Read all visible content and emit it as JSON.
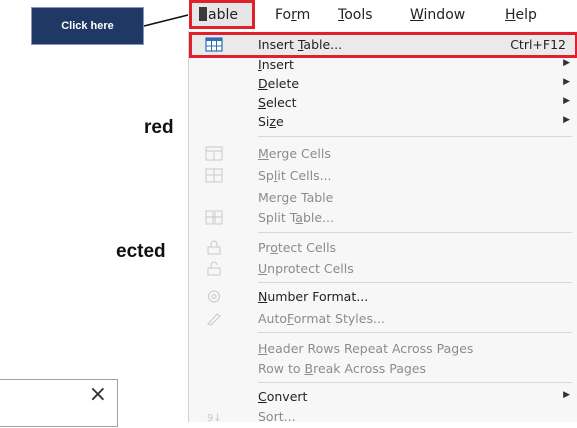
{
  "callout": {
    "label": "Click here"
  },
  "background_text": {
    "line1": "red",
    "line2": "ected"
  },
  "dialog": {
    "close_symbol": "×"
  },
  "menubar": {
    "items": [
      {
        "pre": "",
        "acc": "T",
        "post": "able",
        "display_cut": "able"
      },
      {
        "pre": "Fo",
        "acc": "r",
        "post": "m"
      },
      {
        "pre": "",
        "acc": "T",
        "post": "ools"
      },
      {
        "pre": "",
        "acc": "W",
        "post": "indow"
      },
      {
        "pre": "",
        "acc": "H",
        "post": "elp"
      }
    ]
  },
  "menu": {
    "items": [
      {
        "pre": "Insert ",
        "acc": "T",
        "post": "able...",
        "shortcut": "Ctrl+F12",
        "enabled": true,
        "icon": "insert-table-icon"
      },
      {
        "pre": "",
        "acc": "I",
        "post": "nsert",
        "submenu": true,
        "enabled": true
      },
      {
        "pre": "",
        "acc": "D",
        "post": "elete",
        "submenu": true,
        "enabled": true
      },
      {
        "pre": "",
        "acc": "S",
        "post": "elect",
        "submenu": true,
        "enabled": true
      },
      {
        "pre": "Si",
        "acc": "z",
        "post": "e",
        "submenu": true,
        "enabled": true
      },
      {
        "pre": "",
        "acc": "M",
        "post": "erge Cells",
        "enabled": false,
        "icon": "merge-cells-icon"
      },
      {
        "pre": "Sp",
        "acc": "l",
        "post": "it Cells...",
        "enabled": false,
        "icon": "split-cells-icon"
      },
      {
        "pre": "Mer",
        "acc": "g",
        "post": "e Table",
        "enabled": false
      },
      {
        "pre": "Split T",
        "acc": "a",
        "post": "ble...",
        "enabled": false,
        "icon": "split-table-icon"
      },
      {
        "pre": "Pr",
        "acc": "o",
        "post": "tect Cells",
        "enabled": false,
        "icon": "protect-cells-icon"
      },
      {
        "pre": "",
        "acc": "U",
        "post": "nprotect Cells",
        "enabled": false,
        "icon": "unprotect-cells-icon"
      },
      {
        "pre": "",
        "acc": "N",
        "post": "umber Format...",
        "enabled": false,
        "icon": "number-format-icon"
      },
      {
        "pre": "Auto",
        "acc": "F",
        "post": "ormat Styles...",
        "enabled": false,
        "icon": "autoformat-icon"
      },
      {
        "pre": "",
        "acc": "H",
        "post": "eader Rows Repeat Across Pages",
        "enabled": false
      },
      {
        "pre": "Row to ",
        "acc": "B",
        "post": "reak Across Pages",
        "enabled": false
      },
      {
        "pre": "",
        "acc": "C",
        "post": "onvert",
        "submenu": true,
        "enabled": true
      },
      {
        "pre": "Sort...",
        "acc": "",
        "post": "",
        "enabled": false,
        "icon": "sort-icon"
      }
    ]
  },
  "colors": {
    "highlight_border": "#e0202c",
    "callout_bg": "#1f3864"
  }
}
